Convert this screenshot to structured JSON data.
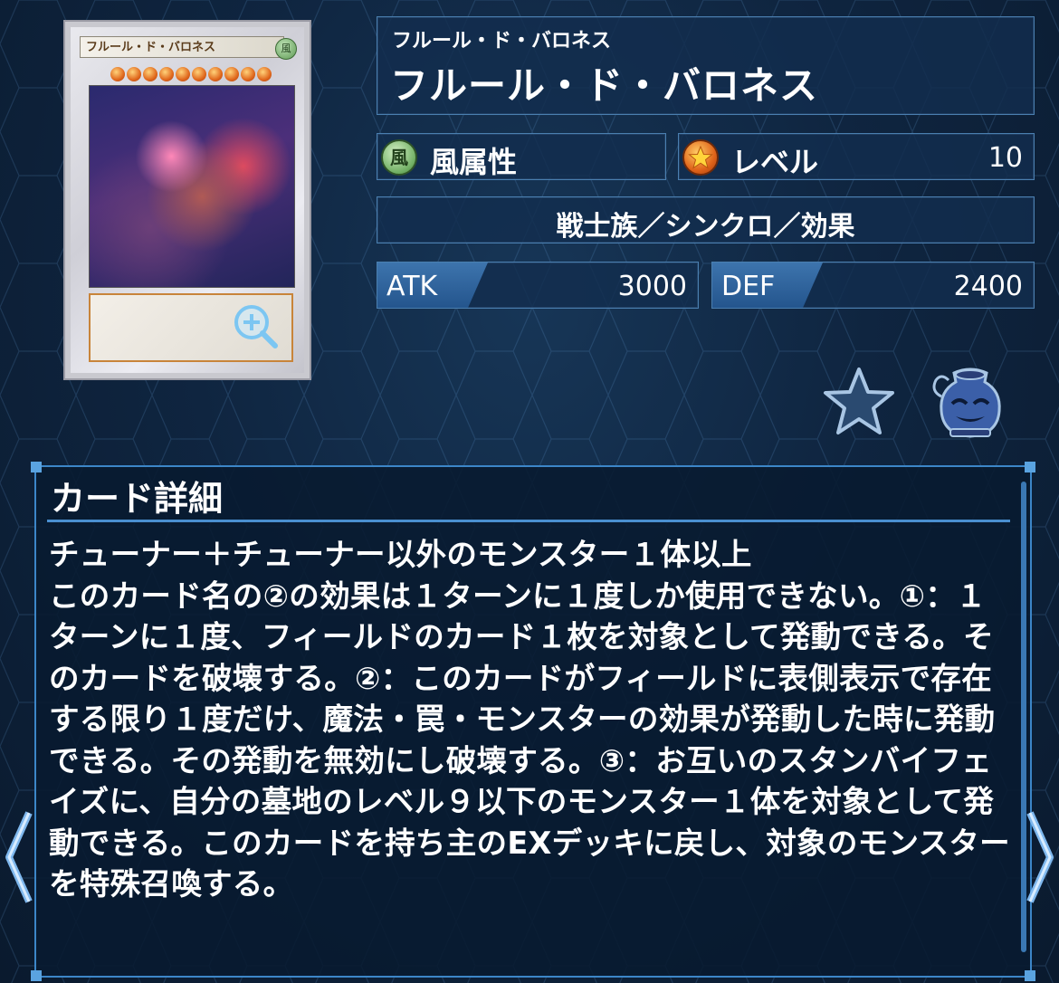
{
  "card_image": {
    "name": "フルール・ド・バロネス",
    "attribute_glyph": "風",
    "stars": 10
  },
  "name": {
    "ruby": "フルール・ド・バロネス",
    "title": "フルール・ド・バロネス"
  },
  "attribute": {
    "icon": "wind-attribute-icon",
    "glyph": "風",
    "label": "風属性"
  },
  "level": {
    "icon": "level-star-icon",
    "label": "レベル",
    "value": "10"
  },
  "type_line": "戦士族／シンクロ／効果",
  "stats": {
    "atk": {
      "label": "ATK",
      "value": "3000"
    },
    "def": {
      "label": "DEF",
      "value": "2400"
    }
  },
  "actions": {
    "favorite": "star-icon",
    "deck_pot": "pot-icon",
    "zoom": "zoom-in-icon"
  },
  "detail": {
    "heading": "カード詳細",
    "text": "チューナー＋チューナー以外のモンスター１体以上\nこのカード名の②の効果は１ターンに１度しか使用できない。①：１ターンに１度、フィールドのカード１枚を対象として発動できる。そのカードを破壊する。②：このカードがフィールドに表側表示で存在する限り１度だけ、魔法・罠・モンスターの効果が発動した時に発動できる。その発動を無効にし破壊する。③：お互いのスタンバイフェイズに、自分の墓地のレベル９以下のモンスター１体を対象として発動できる。このカードを持ち主のEXデッキに戻し、対象のモンスターを特殊召喚する。"
  },
  "colors": {
    "panel_border": "#4a7fb0",
    "accent": "#3c86c8",
    "background": "#0f2238"
  }
}
